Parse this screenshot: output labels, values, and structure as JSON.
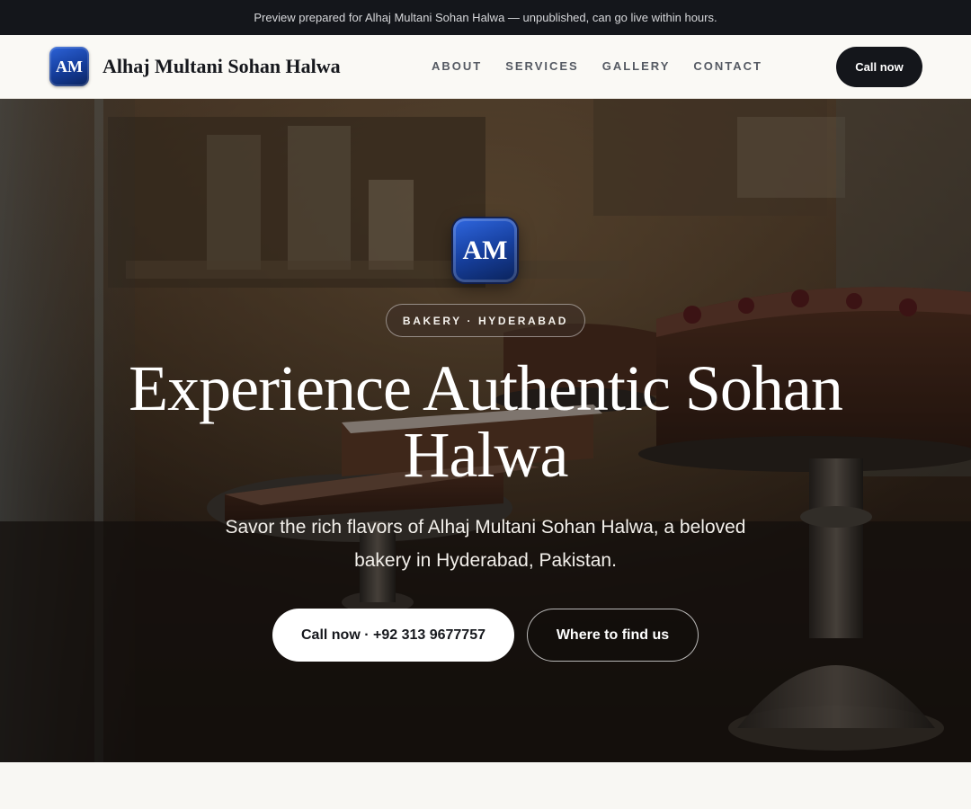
{
  "announcement": {
    "text": "Preview prepared for Alhaj Multani Sohan Halwa — unpublished, can go live within hours."
  },
  "header": {
    "logo_text": "AM",
    "brand_name": "Alhaj Multani Sohan Halwa",
    "nav": [
      {
        "label": "ABOUT"
      },
      {
        "label": "SERVICES"
      },
      {
        "label": "GALLERY"
      },
      {
        "label": "CONTACT"
      }
    ],
    "cta_label": "Call now"
  },
  "hero": {
    "logo_text": "AM",
    "badge": "BAKERY · HYDERABAD",
    "title": "Experience Authentic Sohan Halwa",
    "subtitle": "Savor the rich flavors of Alhaj Multani Sohan Halwa, a beloved bakery in Hyderabad, Pakistan.",
    "primary_button": "Call now · +92 313 9677757",
    "secondary_button": "Where to find us",
    "background_image": "bakery display counter with cakes on stands"
  },
  "colors": {
    "topbar_bg": "#14161b",
    "nav_bg": "#faf9f5",
    "accent_dark": "#14161b",
    "logo_blue": "#17409f"
  }
}
